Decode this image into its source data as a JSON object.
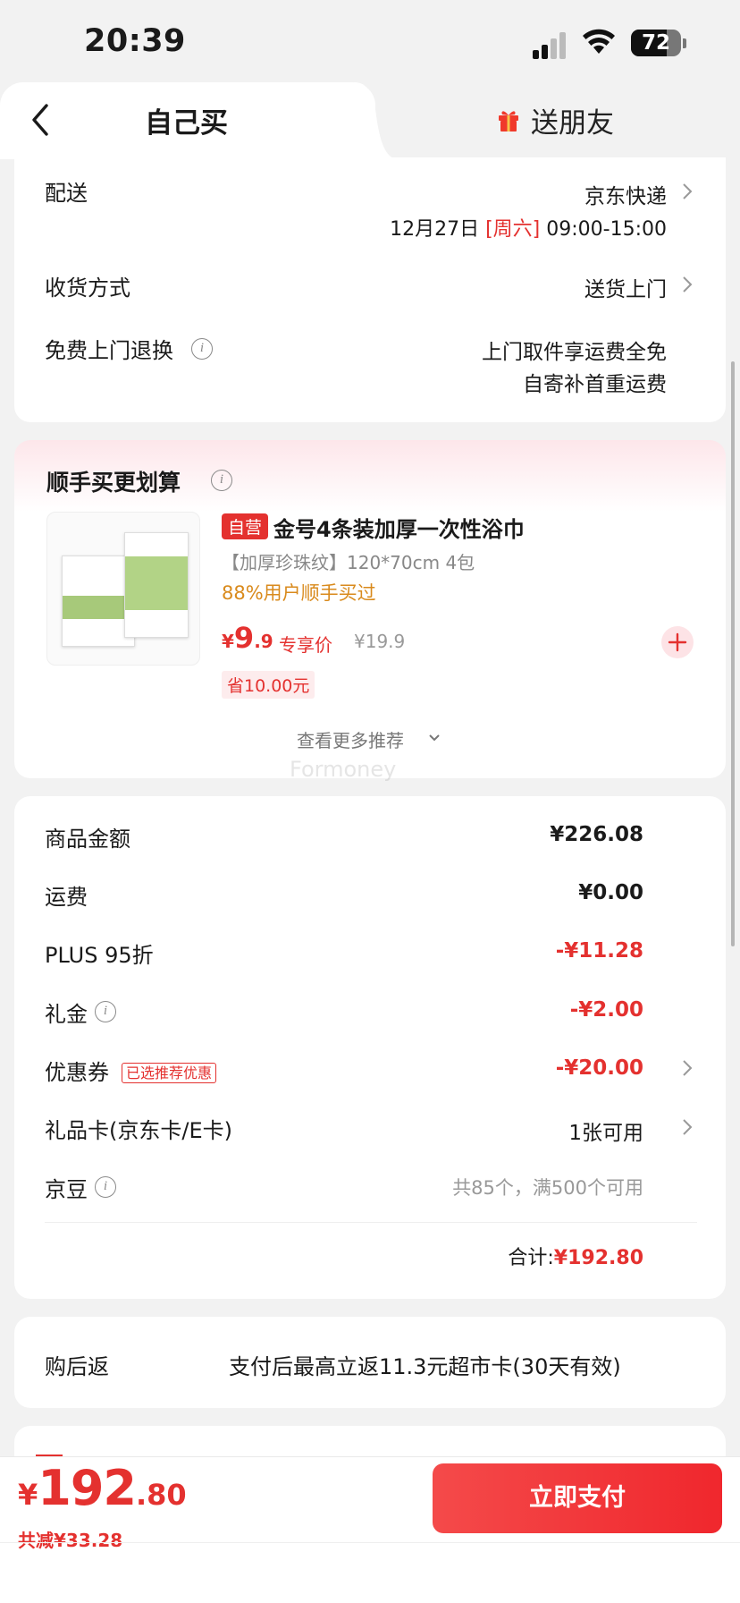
{
  "status_bar": {
    "time": "20:39",
    "battery": "72",
    "battery_level": 0.72
  },
  "tabs": {
    "self": "自己买",
    "friend": "送朋友"
  },
  "delivery": {
    "label": "配送",
    "courier": "京东快递",
    "date": "12月27日",
    "weekday": "[周六]",
    "time": "09:00-15:00",
    "receive_label": "收货方式",
    "receive_value": "送货上门",
    "free_return_label": "免费上门退换",
    "free_return_line1": "上门取件享运费全免",
    "free_return_line2": "自寄补首重运费"
  },
  "addon": {
    "title": "顺手买更划算",
    "badge": "自营",
    "name": "金号4条装加厚一次性浴巾",
    "spec": "【加厚珍珠纹】120*70cm 4包",
    "buyers": "88%用户顺手买过",
    "price_symbol": "¥",
    "price_int": "9",
    "price_dec": ".9",
    "price_tag": "专享价",
    "orig_price": "¥19.9",
    "save": "省10.00元",
    "more": "查看更多推荐",
    "watermark": "Formoney"
  },
  "summary": {
    "goods_label": "商品金额",
    "goods_value": "¥226.08",
    "ship_label": "运费",
    "ship_value": "¥0.00",
    "plus_label": "PLUS 95折",
    "plus_value": "-¥11.28",
    "gift_label": "礼金",
    "gift_value": "-¥2.00",
    "coupon_label": "优惠券",
    "coupon_badge": "已选推荐优惠",
    "coupon_value": "-¥20.00",
    "card_label": "礼品卡(京东卡/E卡)",
    "card_value": "1张可用",
    "bean_label": "京豆",
    "bean_value": "共85个，满500个可用",
    "total_label": "合计:",
    "total_value": "¥192.80"
  },
  "rebate": {
    "label": "购后返",
    "value": "支付后最高立返11.3元超市卡(30天有效)"
  },
  "footer": {
    "symbol": "¥",
    "int": "192",
    "dec": ".80",
    "saved": "共减¥33.28",
    "pay": "立即支付"
  },
  "colors": {
    "accent": "#e4312f",
    "orange": "#d98a1c"
  }
}
